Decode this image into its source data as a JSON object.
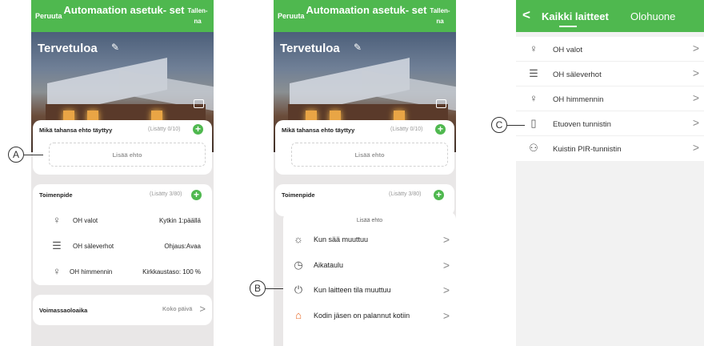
{
  "panel1": {
    "header": {
      "cancel": "Peruuta",
      "title": "Automaation asetuk- set",
      "save": "Tallen- na"
    },
    "hero": {
      "welcome": "Tervetuloa"
    },
    "condition": {
      "label": "Mikä tahansa ehto täyttyy",
      "count": "(Lisätty 0/10)",
      "add_label": "Lisää ehto"
    },
    "actions": {
      "label": "Toimenpide",
      "count": "(Lisätty 3/80)",
      "items": [
        {
          "name": "OH valot",
          "value": "Kytkin 1:päällä",
          "icon": "bulb-icon"
        },
        {
          "name": "OH säleverhot",
          "value": "Ohjaus:Avaa",
          "icon": "blinds-icon"
        },
        {
          "name": "OH himmennin",
          "value": "Kirkkaustaso: 100 %",
          "icon": "dimmer-icon"
        }
      ]
    },
    "validity": {
      "label": "Voimassaoloaika",
      "value": "Koko päivä"
    }
  },
  "panel2": {
    "header": {
      "cancel": "Peruuta",
      "title": "Automaation asetuk- set",
      "save": "Tallen- na"
    },
    "hero": {
      "welcome": "Tervetuloa"
    },
    "condition": {
      "label": "Mikä tahansa ehto täyttyy",
      "count": "(Lisätty 0/10)",
      "add_label": "Lisää ehto"
    },
    "actions": {
      "label": "Toimenpide",
      "count": "(Lisätty 3/80)"
    },
    "sheet": {
      "title": "Lisää ehto",
      "items": [
        {
          "label": "Kun sää muuttuu",
          "icon": "weather-icon"
        },
        {
          "label": "Aikataulu",
          "icon": "clock-icon"
        },
        {
          "label": "Kun laitteen tila muuttuu",
          "icon": "power-icon"
        },
        {
          "label": "Kodin jäsen on palannut kotiin",
          "icon": "home-arrival-icon"
        }
      ]
    }
  },
  "panel3": {
    "header": {
      "tab_all": "Kaikki laitteet",
      "tab_room": "Olohuone"
    },
    "devices": [
      {
        "name": "OH valot",
        "icon": "bulb-icon"
      },
      {
        "name": "OH säleverhot",
        "icon": "blinds-icon"
      },
      {
        "name": "OH himmennin",
        "icon": "dimmer-icon"
      },
      {
        "name": "Etuoven tunnistin",
        "icon": "door-sensor-icon"
      },
      {
        "name": "Kuistin PIR-tunnistin",
        "icon": "motion-sensor-icon"
      }
    ]
  },
  "callouts": {
    "a": "A",
    "b": "B",
    "c": "C"
  },
  "colors": {
    "accent": "#4fb84f",
    "background": "#e9e7e7",
    "orange_icon": "#e8641e"
  }
}
